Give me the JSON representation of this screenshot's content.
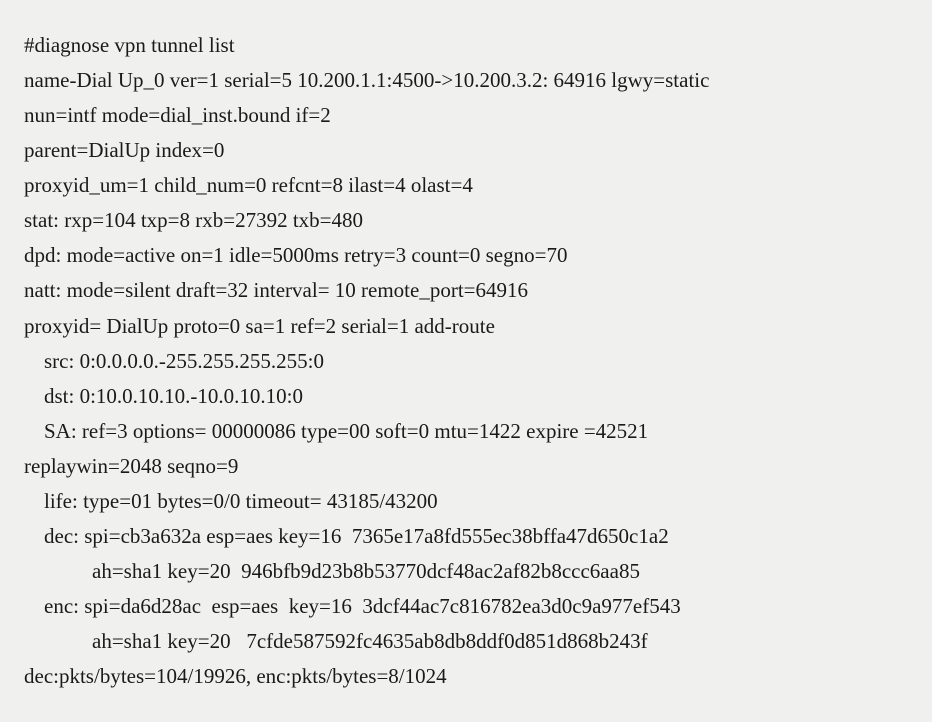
{
  "lines": {
    "l1": "#diagnose vpn tunnel list",
    "l2": "name-Dial Up_0 ver=1 serial=5 10.200.1.1:4500->10.200.3.2: 64916 lgwy=static",
    "l3": "nun=intf mode=dial_inst.bound if=2",
    "l4": "parent=DialUp index=0",
    "l5": "proxyid_um=1 child_num=0 refcnt=8 ilast=4 olast=4",
    "l6": "stat: rxp=104 txp=8 rxb=27392 txb=480",
    "l7": "dpd: mode=active on=1 idle=5000ms retry=3 count=0 segno=70",
    "l8": "natt: mode=silent draft=32 interval= 10 remote_port=64916",
    "l9": "proxyid= DialUp proto=0 sa=1 ref=2 serial=1 add-route",
    "l10": "src: 0:0.0.0.0.-255.255.255.255:0",
    "l11": "dst: 0:10.0.10.10.-10.0.10.10:0",
    "l12": "SA: ref=3 options= 00000086 type=00 soft=0 mtu=1422 expire =42521",
    "l13": "replaywin=2048 seqno=9",
    "l14": "life: type=01 bytes=0/0 timeout= 43185/43200",
    "l15": "dec: spi=cb3a632a esp=aes key=16  7365e17a8fd555ec38bffa47d650c1a2",
    "l16": "ah=sha1 key=20  946bfb9d23b8b53770dcf48ac2af82b8ccc6aa85",
    "l17": "enc: spi=da6d28ac  esp=aes  key=16  3dcf44ac7c816782ea3d0c9a977ef543",
    "l18": "ah=sha1 key=20   7cfde587592fc4635ab8db8ddf0d851d868b243f",
    "l19": "dec:pkts/bytes=104/19926, enc:pkts/bytes=8/1024"
  }
}
